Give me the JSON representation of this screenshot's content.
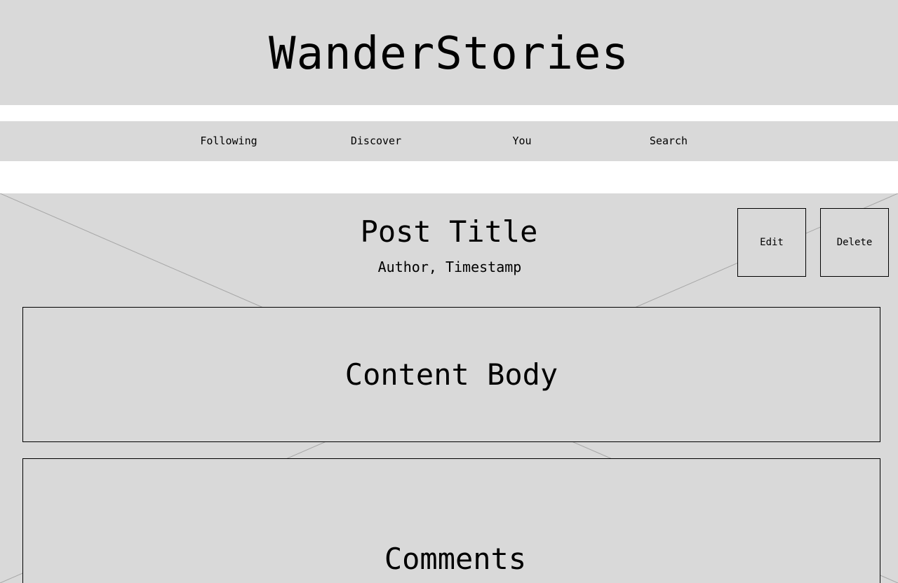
{
  "header": {
    "title": "WanderStories"
  },
  "nav": {
    "items": [
      {
        "label": "Following"
      },
      {
        "label": "Discover"
      },
      {
        "label": "You"
      },
      {
        "label": "Search"
      }
    ]
  },
  "post": {
    "title": "Post Title",
    "meta": "Author, Timestamp",
    "actions": {
      "edit_label": "Edit",
      "delete_label": "Delete"
    },
    "content_label": "Content Body",
    "comments_label": "Comments"
  },
  "colors": {
    "panel": "#d9d9d9",
    "background": "#ffffff",
    "border": "#000000",
    "placeholder_lines": "#a6a6a6"
  }
}
